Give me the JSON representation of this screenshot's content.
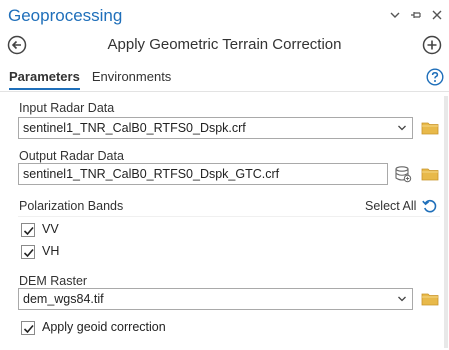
{
  "pane": {
    "title": "Geoprocessing",
    "controls": [
      "options-icon",
      "pin-icon",
      "close-icon"
    ]
  },
  "tool": {
    "title": "Apply Geometric Terrain Correction"
  },
  "tabs": [
    {
      "label": "Parameters",
      "active": true
    },
    {
      "label": "Environments",
      "active": false
    }
  ],
  "params": {
    "input_radar": {
      "label": "Input Radar  Data",
      "value": "sentinel1_TNR_CalB0_RTFS0_Dspk.crf"
    },
    "output_radar": {
      "label": "Output Radar Data",
      "value": "sentinel1_TNR_CalB0_RTFS0_Dspk_GTC.crf"
    },
    "polarization": {
      "label": "Polarization Bands",
      "select_all_label": "Select All",
      "bands": [
        {
          "label": "VV",
          "checked": true
        },
        {
          "label": "VH",
          "checked": true
        }
      ]
    },
    "dem": {
      "label": "DEM Raster",
      "value": "dem_wgs84.tif"
    },
    "geoid": {
      "label": "Apply geoid correction",
      "checked": true
    }
  },
  "colors": {
    "accent": "#1f6fba",
    "folder": "#e8b94a"
  }
}
